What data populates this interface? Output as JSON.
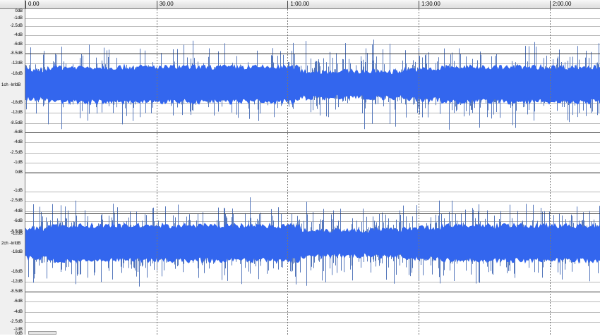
{
  "ruler": {
    "ticks": [
      {
        "label": "0.00",
        "seconds": 0
      },
      {
        "label": "30.00",
        "seconds": 30
      },
      {
        "label": "1:00.00",
        "seconds": 60
      },
      {
        "label": "1:30.00",
        "seconds": 90
      },
      {
        "label": "2:00.00",
        "seconds": 120
      }
    ],
    "visible_seconds": 131.5
  },
  "channels": [
    {
      "name": "1ch -InfdB",
      "scale_labels": [
        "0dB",
        "-1dB",
        "-2.5dB",
        "-4dB",
        "-6dB",
        "-8.5dB",
        "-12dB",
        "-18dB",
        "-18dB",
        "-12dB",
        "-8.5dB",
        "-6dB",
        "-4dB",
        "-2.5dB",
        "-1dB",
        "0dB"
      ]
    },
    {
      "name": "2ch -InfdB",
      "scale_labels": [
        "-1dB",
        "-2.5dB",
        "-4dB",
        "-6dB",
        "-8.5dB",
        "-12dB",
        "-18dB",
        "-18dB",
        "-12dB",
        "-8.5dB",
        "-6dB",
        "-4dB",
        "-2.5dB",
        "-1dB",
        "0dB"
      ]
    }
  ],
  "colors": {
    "waveform_body": "#3366ee",
    "waveform_peak": "#5577bb",
    "gridline": "#b8b8b8",
    "reference_line": "#333333",
    "time_marker": "#777777"
  }
}
